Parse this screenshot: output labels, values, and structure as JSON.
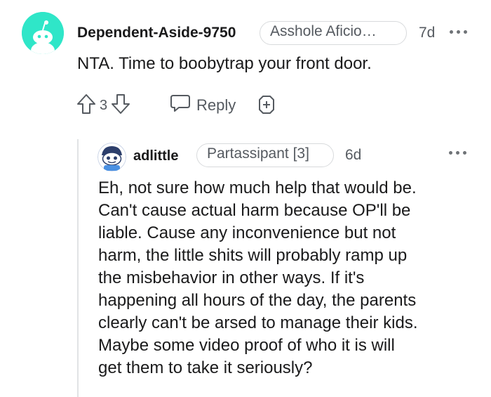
{
  "comment": {
    "username": "Dependent-Aside-9750",
    "flair": "Asshole Aficio…",
    "time": "7d",
    "body": "NTA. Time to boobytrap your front door.",
    "vote_count": "3",
    "reply_label": "Reply"
  },
  "reply": {
    "username": "adlittle",
    "flair": "Partassipant [3]",
    "time": "6d",
    "body_lines": [
      "Eh, not sure how much help that would be.",
      "Can't cause actual harm because OP'll be",
      "liable. Cause any inconvenience but not",
      "harm, the little shits will probably ramp up",
      "the misbehavior in other ways. If it's",
      "happening all hours of the day, the parents",
      "clearly can't be arsed to manage their kids.",
      "Maybe some video proof of who it is will",
      "get them to take it seriously?"
    ]
  },
  "colors": {
    "avatar1_bg": "#2fe6c8",
    "text": "#1a1a1b",
    "meta": "#555a60",
    "thread_line": "#e1e3e5"
  },
  "icons": [
    "upvote-icon",
    "downvote-icon",
    "reply-icon",
    "award-icon",
    "more-options-icon",
    "snoo-avatar-icon"
  ]
}
